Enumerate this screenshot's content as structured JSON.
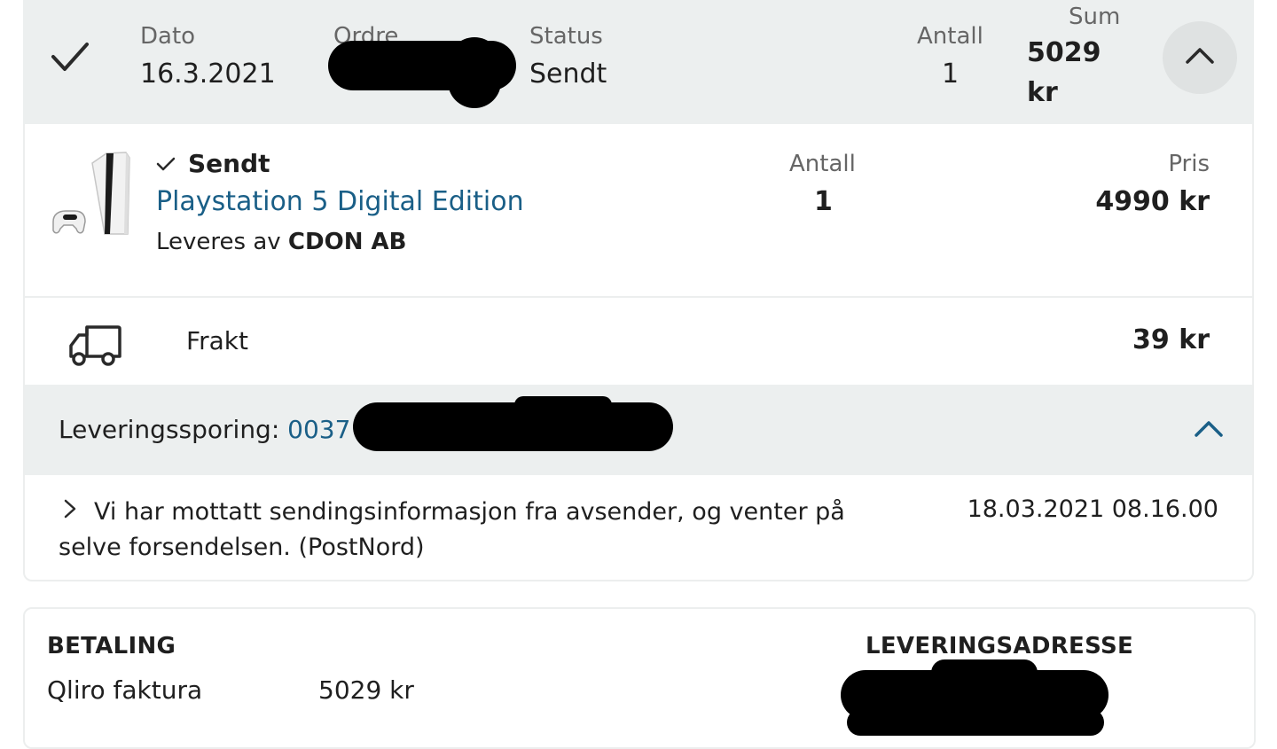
{
  "order_header": {
    "date_label": "Dato",
    "date_value": "16.3.2021",
    "order_label": "Ordre",
    "status_label": "Status",
    "status_value": "Sendt",
    "quantity_label": "Antall",
    "quantity_value": "1",
    "sum_label": "Sum",
    "sum_value_line1": "5029",
    "sum_value_line2": "kr"
  },
  "item": {
    "status": "Sendt",
    "name": "Playstation 5 Digital Edition",
    "delivered_by_prefix": "Leveres av",
    "seller": "CDON AB",
    "quantity_label": "Antall",
    "quantity_value": "1",
    "price_label": "Pris",
    "price_value": "4990 kr"
  },
  "shipping": {
    "label": "Frakt",
    "price": "39 kr"
  },
  "tracking": {
    "label": "Leveringssporing:",
    "number_visible": "0037",
    "event_text": "Vi har mottatt sendingsinformasjon fra avsender, og venter på selve forsendelsen. (PostNord)",
    "event_time": "18.03.2021 08.16.00"
  },
  "payment": {
    "heading": "BETALING",
    "method": "Qliro faktura",
    "amount": "5029 kr"
  },
  "delivery_address": {
    "heading": "LEVERINGSADRESSE"
  },
  "colors": {
    "header_bg": "#ecefef",
    "link": "#1a5f87",
    "redaction": "#000000"
  }
}
